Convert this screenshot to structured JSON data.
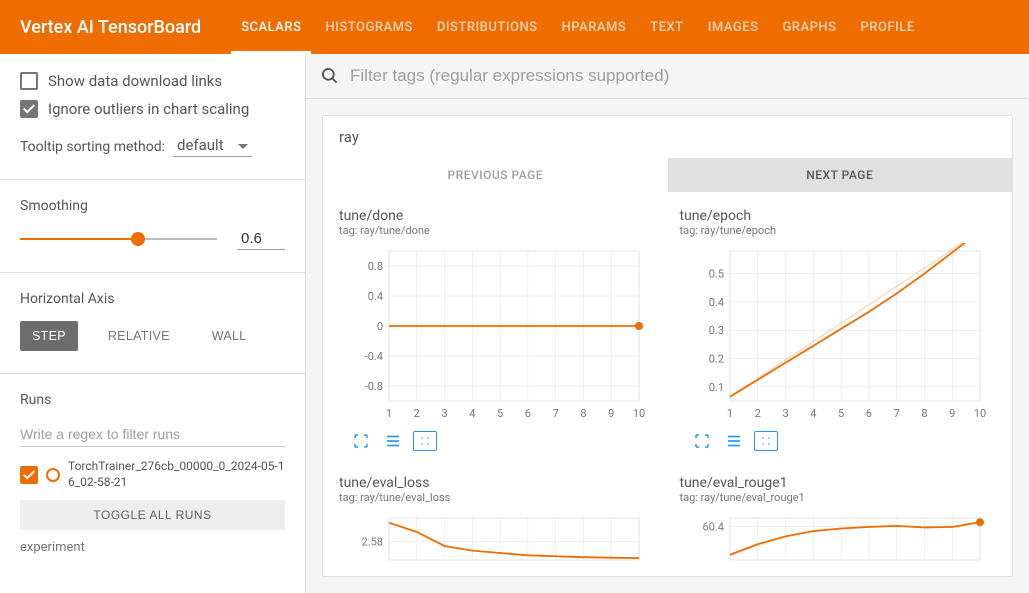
{
  "header": {
    "title": "Vertex AI TensorBoard",
    "tabs": [
      "SCALARS",
      "HISTOGRAMS",
      "DISTRIBUTIONS",
      "HPARAMS",
      "TEXT",
      "IMAGES",
      "GRAPHS",
      "PROFILE"
    ],
    "active_tab": "SCALARS"
  },
  "sidebar": {
    "show_download_label": "Show data download links",
    "show_download_checked": false,
    "ignore_outliers_label": "Ignore outliers in chart scaling",
    "ignore_outliers_checked": true,
    "tooltip_label": "Tooltip sorting method:",
    "tooltip_value": "default",
    "smoothing": {
      "heading": "Smoothing",
      "value": "0.6",
      "percent": 60
    },
    "axis": {
      "heading": "Horizontal Axis",
      "options": [
        "STEP",
        "RELATIVE",
        "WALL"
      ],
      "active": "STEP"
    },
    "runs": {
      "heading": "Runs",
      "filter_placeholder": "Write a regex to filter runs",
      "items": [
        {
          "name": "TorchTrainer_276cb_00000_0_2024-05-16_02-58-21",
          "checked": true
        }
      ],
      "toggle_label": "TOGGLE ALL RUNS",
      "experiment_label": "experiment"
    }
  },
  "main": {
    "tag_filter_placeholder": "Filter tags (regular expressions supported)",
    "category": "ray",
    "pager": {
      "prev": "PREVIOUS PAGE",
      "next": "NEXT PAGE",
      "active": "next"
    }
  },
  "chart_data": [
    {
      "title": "tune/done",
      "tag": "tag: ray/tune/done",
      "type": "line",
      "x": [
        1,
        2,
        3,
        4,
        5,
        6,
        7,
        8,
        9,
        10
      ],
      "y": [
        0,
        0,
        0,
        0,
        0,
        0,
        0,
        0,
        0,
        0
      ],
      "xrange": [
        1,
        10
      ],
      "yrange": [
        -1,
        1
      ],
      "yticks": [
        -0.8,
        -0.4,
        0,
        0.4,
        0.8
      ],
      "xlabel": "",
      "ylabel": "",
      "color": "#ef6c00",
      "end_marker": true
    },
    {
      "title": "tune/epoch",
      "tag": "tag: ray/tune/epoch",
      "type": "line",
      "x": [
        1,
        2,
        3,
        4,
        5,
        6,
        7,
        8,
        9,
        10
      ],
      "y": [
        0.065,
        0.125,
        0.185,
        0.245,
        0.305,
        0.365,
        0.43,
        0.5,
        0.575,
        0.65
      ],
      "xrange": [
        1,
        10
      ],
      "yrange": [
        0.05,
        0.58
      ],
      "yticks": [
        0.1,
        0.2,
        0.3,
        0.4,
        0.5
      ],
      "xlabel": "",
      "ylabel": "",
      "color": "#ef6c00",
      "faint_line": [
        0.065,
        0.13,
        0.195,
        0.26,
        0.325,
        0.39,
        0.455,
        0.52,
        0.585,
        0.65
      ]
    },
    {
      "title": "tune/eval_loss",
      "tag": "tag: ray/tune/eval_loss",
      "type": "line",
      "x": [
        1,
        2,
        3,
        4,
        5,
        6,
        7,
        8,
        9,
        10
      ],
      "y": [
        2.62,
        2.6,
        2.57,
        2.56,
        2.555,
        2.55,
        2.548,
        2.546,
        2.545,
        2.544
      ],
      "xrange": [
        1,
        10
      ],
      "yrange": [
        2.54,
        2.63
      ],
      "yticks": [
        2.58
      ],
      "xlabel": "",
      "ylabel": "",
      "color": "#ef6c00",
      "partial": true
    },
    {
      "title": "tune/eval_rouge1",
      "tag": "tag: ray/tune/eval_rouge1",
      "type": "line",
      "x": [
        1,
        2,
        3,
        4,
        5,
        6,
        7,
        8,
        9,
        10
      ],
      "y": [
        55,
        57,
        58.5,
        59.5,
        60,
        60.3,
        60.5,
        60.2,
        60.3,
        61.2
      ],
      "xrange": [
        1,
        10
      ],
      "yrange": [
        54,
        62
      ],
      "yticks": [
        60.4
      ],
      "xlabel": "",
      "ylabel": "",
      "color": "#ef6c00",
      "partial": true,
      "end_marker": true
    }
  ]
}
